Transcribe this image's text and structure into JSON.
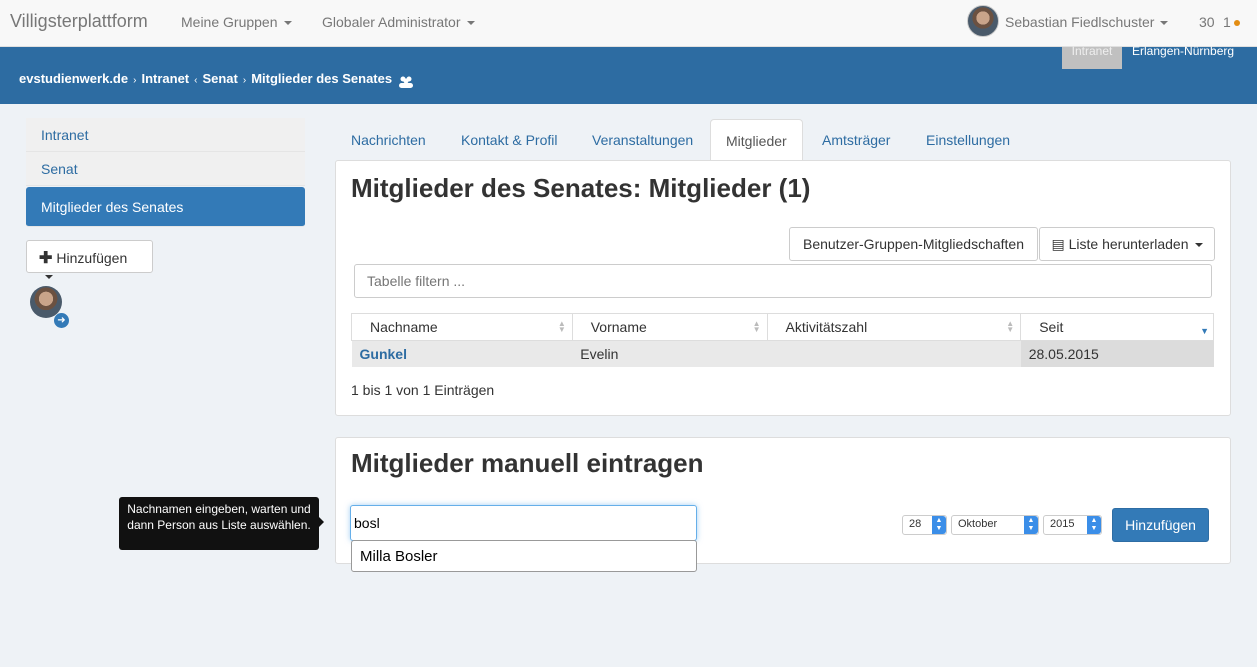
{
  "navbar": {
    "brand": "Villigsterplattform",
    "menus": [
      "Meine Gruppen",
      "Globaler Administrator"
    ],
    "user_name": "Sebastian Fiedlschuster",
    "count": "30",
    "notifications": "1"
  },
  "breadcrumb": [
    "evstudienwerk.de",
    "Intranet",
    "Senat",
    "Mitglieder des Senates"
  ],
  "region": {
    "chip": "Intranet",
    "label": "Erlangen-Nürnberg"
  },
  "sidebar": {
    "items": [
      "Intranet",
      "Senat",
      "Mitglieder des Senates"
    ],
    "add_button": "Hinzufügen"
  },
  "tabs": [
    "Nachrichten",
    "Kontakt & Profil",
    "Veranstaltungen",
    "Mitglieder",
    "Amtsträger",
    "Einstellungen"
  ],
  "members_panel": {
    "title": "Mitglieder des Senates: Mitglieder (1)",
    "memberships_button": "Benutzer-Gruppen-Mitgliedschaften",
    "download_button": "Liste herunterladen",
    "filter_placeholder": "Tabelle filtern ...",
    "columns": [
      "Nachname",
      "Vorname",
      "Aktivitätszahl",
      "Seit"
    ],
    "rows": [
      {
        "last_name": "Gunkel",
        "first_name": "Evelin",
        "activity": "",
        "since": "28.05.2015"
      }
    ],
    "info": "1 bis 1 von 1 Einträgen"
  },
  "manual_panel": {
    "title": "Mitglieder manuell eintragen",
    "tooltip": "Nachnamen eingeben, warten und dann Person aus Liste auswählen.",
    "input_value": "bosl",
    "suggestion": "Milla Bosler",
    "day": "28",
    "month": "Oktober",
    "year": "2015",
    "submit": "Hinzufügen"
  },
  "colors": {
    "primary": "#337ab7",
    "bluebar": "#2d6ca2"
  }
}
